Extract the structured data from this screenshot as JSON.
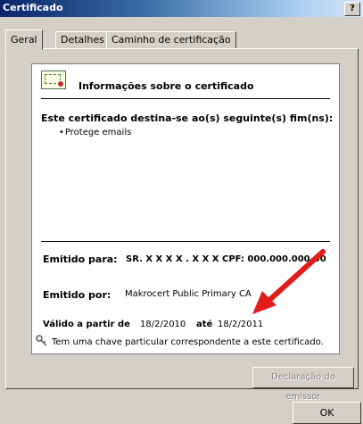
{
  "window": {
    "title": "Certificado",
    "help_button": "?"
  },
  "tabs": [
    "Geral",
    "Detalhes",
    "Caminho de certificação"
  ],
  "header": {
    "title": "Informações sobre o certificado"
  },
  "purposes": {
    "heading": "Este certificado destina-se ao(s) seguinte(s) fim(ns):",
    "items": [
      "Protege emails"
    ]
  },
  "issued_to": {
    "label": "Emitido para:",
    "value": "SR. X X X X . X X X CPF: 000.000.000-00"
  },
  "issued_by": {
    "label": "Emitido por:",
    "value": "Makrocert Public Primary CA"
  },
  "validity": {
    "from_label": "Válido a partir de",
    "from": "18/2/2010",
    "to_label": "até",
    "to": "18/2/2011"
  },
  "private_key": {
    "text": "Tem uma chave particular correspondente a este certificado."
  },
  "buttons": {
    "issuer_statement": "Declaração do emissor",
    "ok": "OK"
  },
  "colors": {
    "dialog": "#d4d0c8",
    "title_bar": "#0a246a",
    "annotation_arrow": "#e31b1b"
  }
}
